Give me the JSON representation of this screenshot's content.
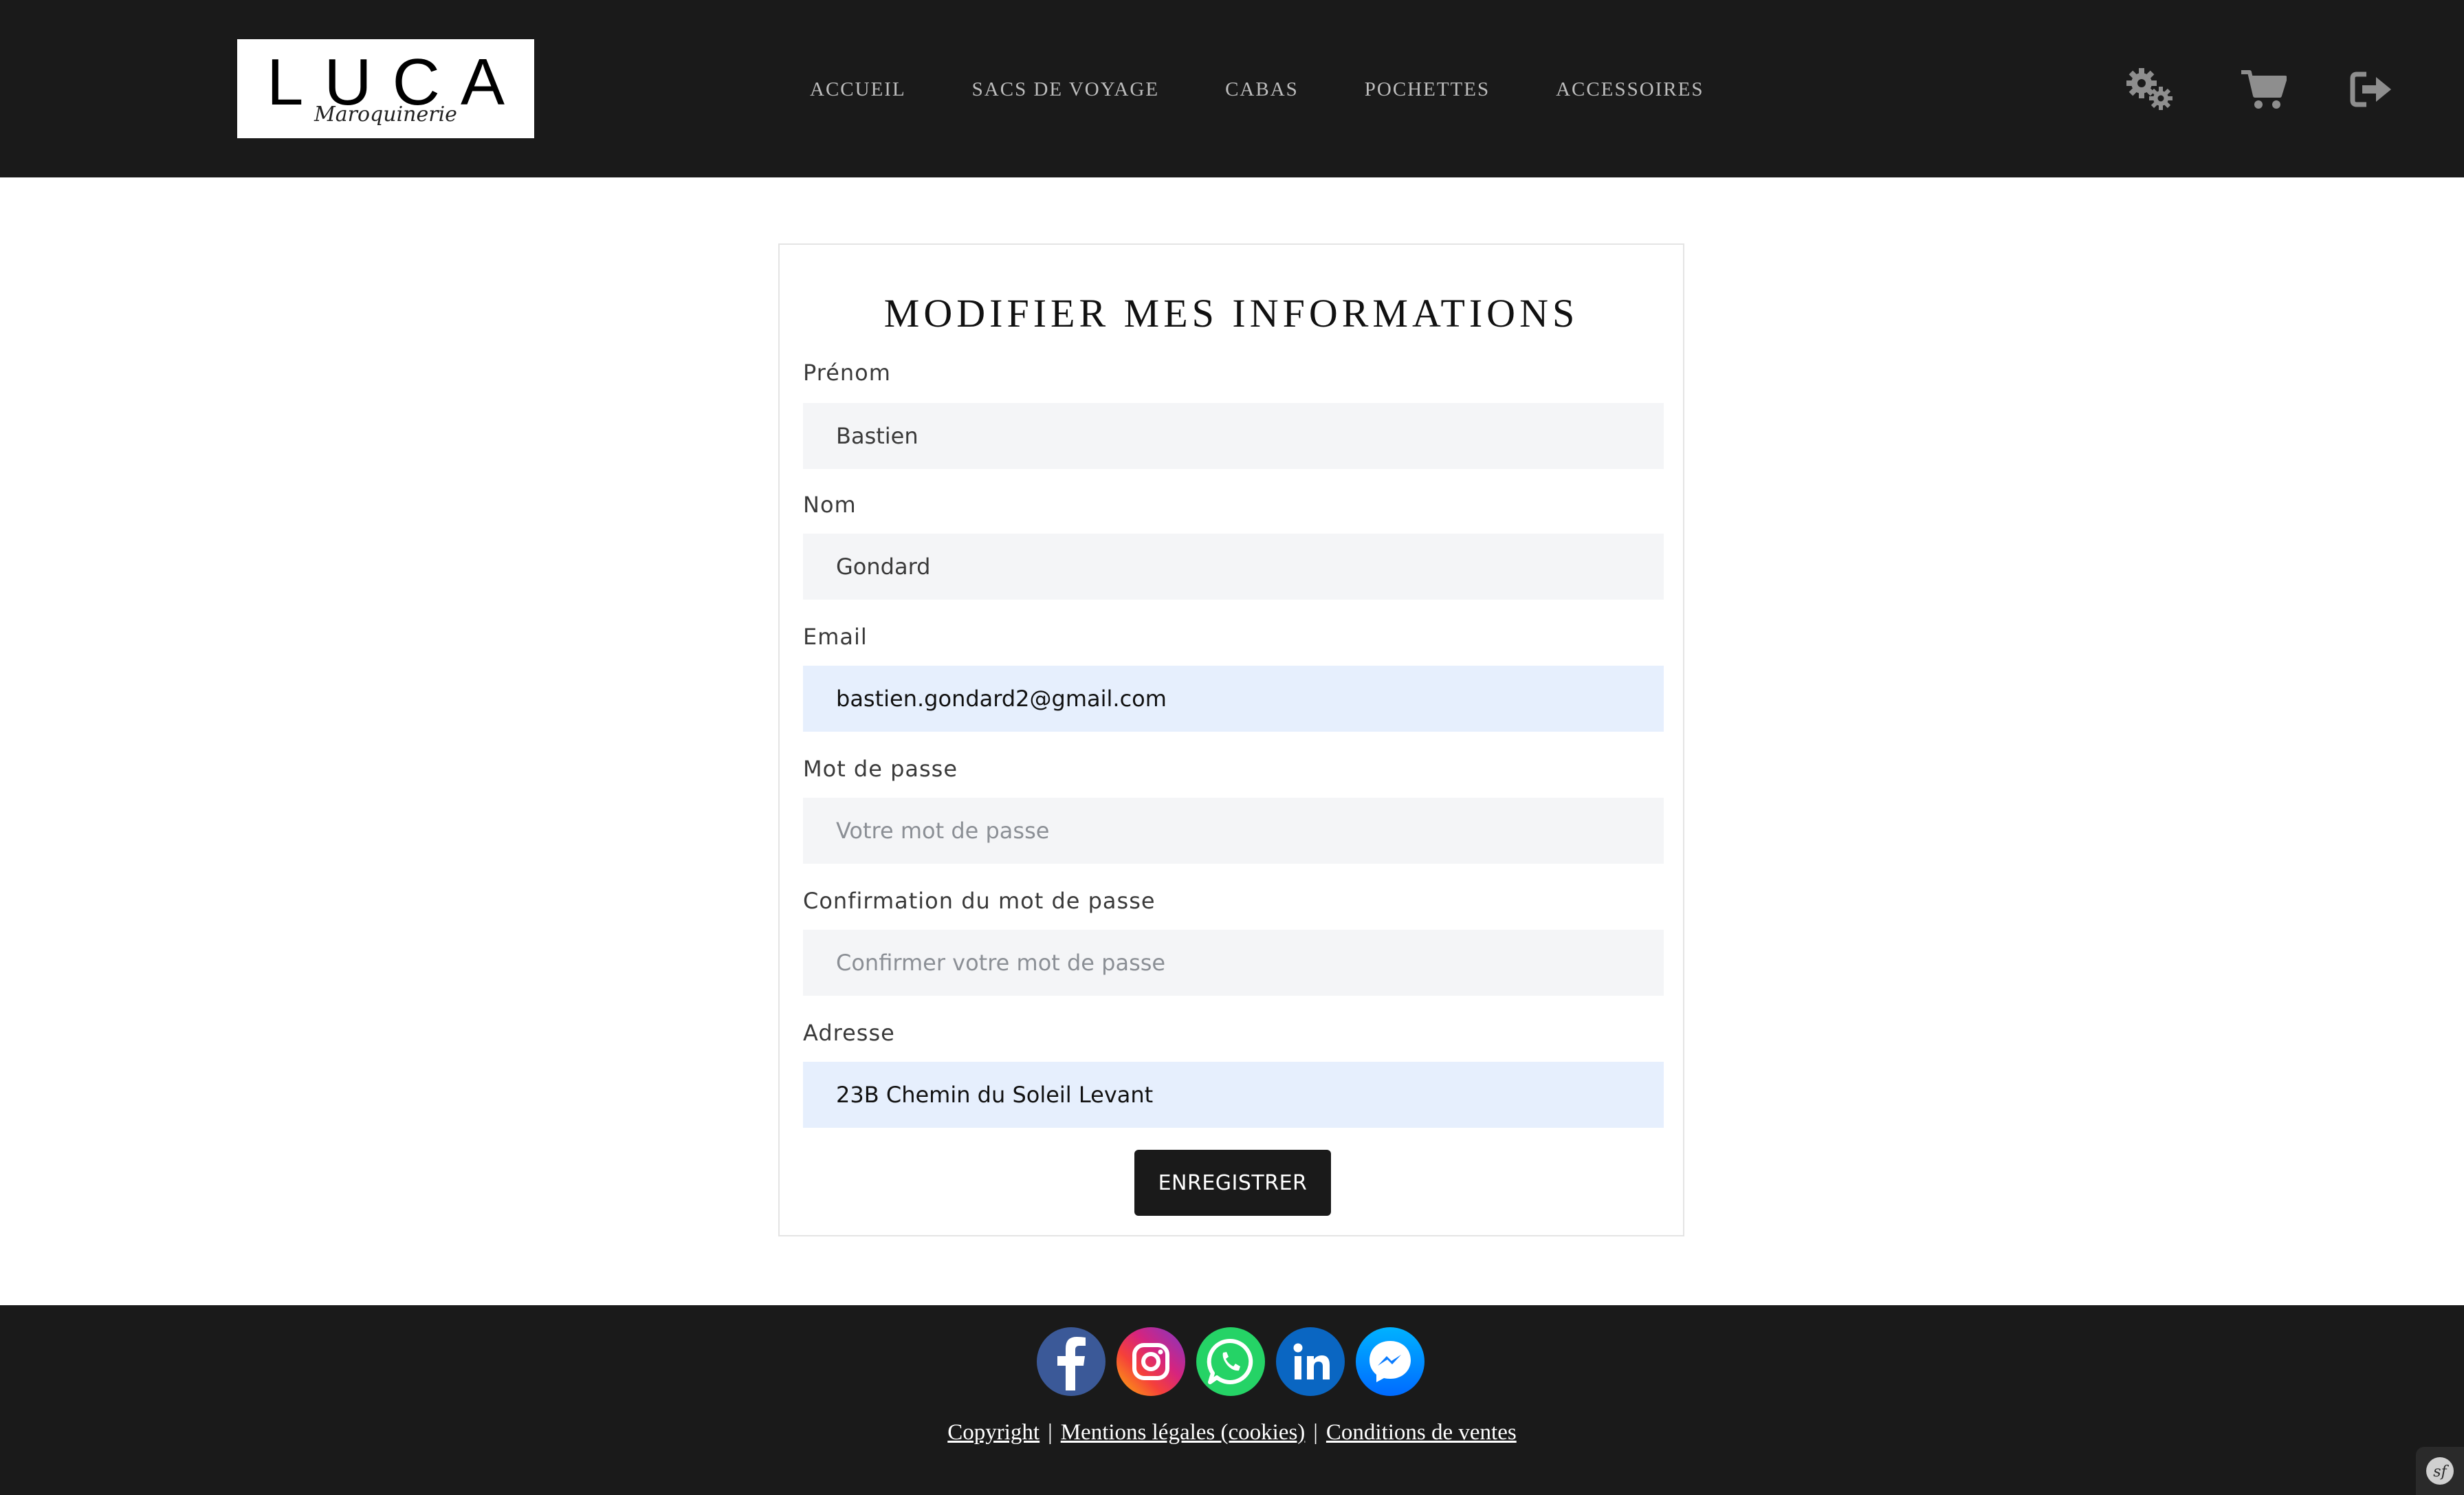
{
  "header": {
    "logo": {
      "word": "LUCA",
      "script": "Maroquinerie"
    },
    "nav": [
      {
        "label": "ACCUEIL"
      },
      {
        "label": "SACS DE VOYAGE"
      },
      {
        "label": "CABAS"
      },
      {
        "label": "POCHETTES"
      },
      {
        "label": "ACCESSOIRES"
      }
    ],
    "icons": [
      "gears-icon",
      "cart-icon",
      "logout-icon"
    ]
  },
  "form": {
    "title": "MODIFIER MES INFORMATIONS",
    "fields": [
      {
        "label": "Prénom",
        "value": "Bastien",
        "placeholder": ""
      },
      {
        "label": "Nom",
        "value": "Gondard",
        "placeholder": ""
      },
      {
        "label": "Email",
        "value": "bastien.gondard2@gmail.com",
        "placeholder": ""
      },
      {
        "label": "Mot de passe",
        "value": "",
        "placeholder": "Votre mot de passe"
      },
      {
        "label": "Confirmation du mot de passe",
        "value": "",
        "placeholder": "Confirmer votre mot de passe"
      },
      {
        "label": "Adresse",
        "value": "23B Chemin du Soleil Levant",
        "placeholder": ""
      }
    ],
    "submit_label": "ENREGISTRER"
  },
  "footer": {
    "social": [
      "facebook-icon",
      "instagram-icon",
      "whatsapp-icon",
      "linkedin-icon",
      "messenger-icon"
    ],
    "links": {
      "copyright": "Copyright",
      "legal": "Mentions légales (cookies)",
      "terms": "Conditions de ventes",
      "separator": "|"
    }
  },
  "colors": {
    "header_bg": "#1a1a1a",
    "nav_text": "#bdbdbd",
    "input_bg": "#f4f5f7",
    "autofill_bg": "#e6effd",
    "button_bg": "#1a1a1a"
  }
}
